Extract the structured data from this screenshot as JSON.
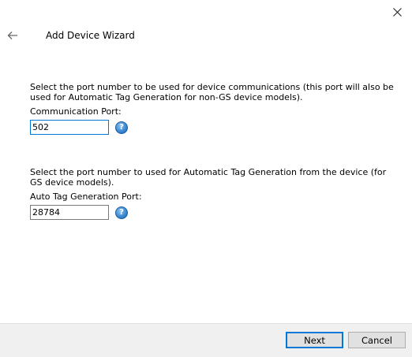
{
  "window": {
    "title": "Add Device Wizard",
    "close_icon": "close-icon",
    "back_icon": "back-arrow-icon"
  },
  "communication": {
    "description": "Select the port number to be used for device communications (this port will also be used for Automatic Tag Generation for non-GS device models).",
    "label": "Communication Port:",
    "value": "502",
    "help_icon": "help-icon"
  },
  "auto_tag": {
    "description": "Select the port number to used for Automatic Tag Generation from the device (for GS device models).",
    "label": "Auto Tag Generation Port:",
    "value": "28784",
    "help_icon": "help-icon"
  },
  "footer": {
    "next_label": "Next",
    "cancel_label": "Cancel"
  },
  "colors": {
    "focus_border": "#0078d7",
    "footer_bg": "#f0f0f0",
    "help_blue": "#3d8ad4"
  }
}
